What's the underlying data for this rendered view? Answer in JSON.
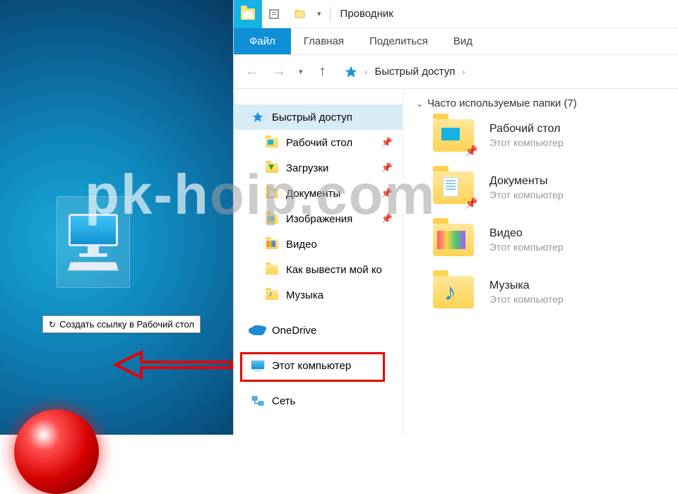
{
  "watermark_left": "pk-h",
  "watermark_right": "oip.com",
  "drag_tip": {
    "icon": "↻",
    "text": "Создать ссылку в Рабочий стол"
  },
  "titlebar": {
    "title": "Проводник"
  },
  "ribbon": {
    "file": "Файл",
    "home": "Главная",
    "share": "Поделиться",
    "view": "Вид"
  },
  "breadcrumb": {
    "root": "Быстрый доступ"
  },
  "nav": {
    "quick_access": "Быстрый доступ",
    "desktop": "Рабочий стол",
    "downloads": "Загрузки",
    "documents": "Документы",
    "pictures": "Изображения",
    "video": "Видео",
    "howto": "Как вывести мой ко",
    "music": "Музыка",
    "onedrive": "OneDrive",
    "this_pc": "Этот компьютер",
    "network": "Сеть"
  },
  "group": {
    "header": "Часто используемые папки (7)"
  },
  "folders": {
    "sub": "Этот компьютер",
    "desktop": "Рабочий стол",
    "documents": "Документы",
    "video": "Видео",
    "music": "Музыка"
  }
}
